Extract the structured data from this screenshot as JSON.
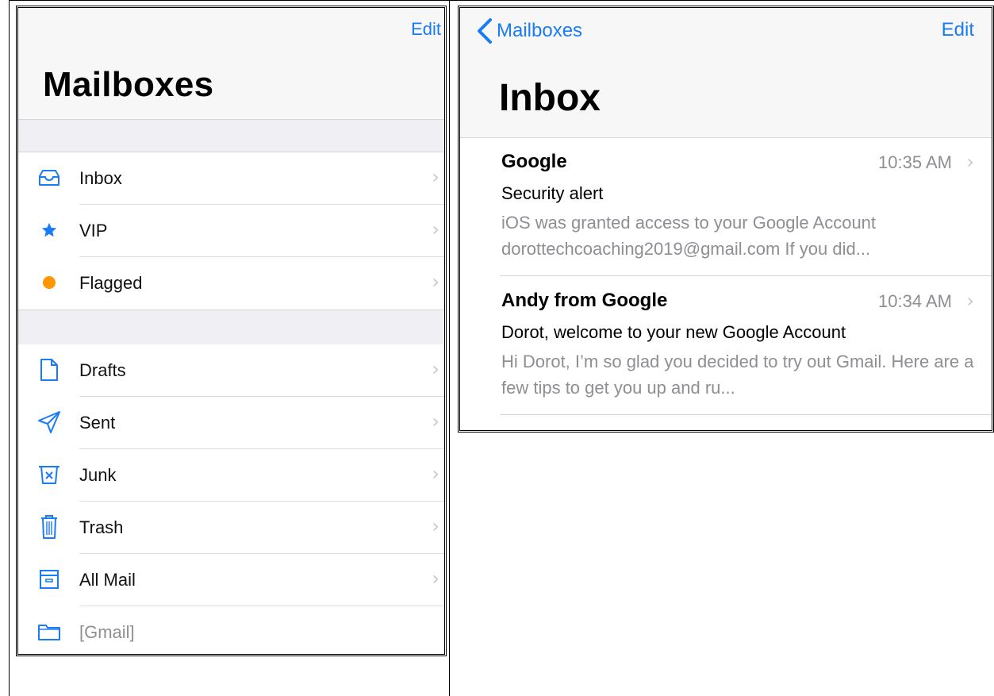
{
  "mailboxes_screen": {
    "edit_label": "Edit",
    "title": "Mailboxes",
    "items": [
      {
        "label": "Inbox",
        "icon": "inbox-icon"
      },
      {
        "label": "VIP",
        "icon": "star-icon"
      },
      {
        "label": "Flagged",
        "icon": "flag-dot-icon"
      },
      {
        "label": "Drafts",
        "icon": "document-icon"
      },
      {
        "label": "Sent",
        "icon": "paper-plane-icon"
      },
      {
        "label": "Junk",
        "icon": "junk-bin-icon"
      },
      {
        "label": "Trash",
        "icon": "trash-icon"
      },
      {
        "label": "All Mail",
        "icon": "archive-box-icon"
      },
      {
        "label": "[Gmail]",
        "icon": "folder-icon"
      }
    ]
  },
  "inbox_screen": {
    "back_label": "Mailboxes",
    "edit_label": "Edit",
    "title": "Inbox",
    "messages": [
      {
        "sender": "Google",
        "time": "10:35 AM",
        "subject": "Security alert",
        "preview": "iOS was granted access to your Google Account dorottechcoaching2019@gmail.com If you did..."
      },
      {
        "sender": "Andy from Google",
        "time": "10:34 AM",
        "subject": "Dorot, welcome to your new Google Account",
        "preview": "Hi Dorot, I’m so glad you decided to try out Gmail. Here are a few tips to get you up and ru..."
      }
    ]
  },
  "colors": {
    "accent": "#1a7cf5",
    "flag": "#ff9500",
    "secondary_text": "#8e8e93",
    "group_background": "#efeff4"
  }
}
